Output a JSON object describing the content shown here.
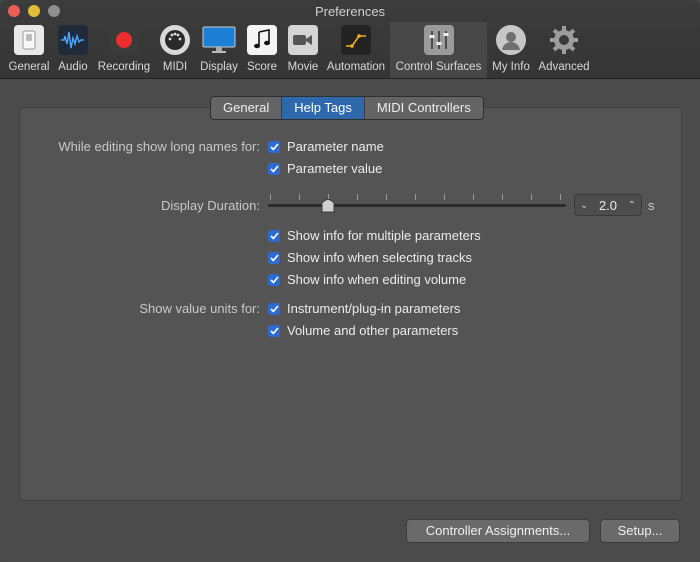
{
  "window": {
    "title": "Preferences"
  },
  "toolbar": {
    "items": [
      {
        "label": "General",
        "icon": "switch-icon"
      },
      {
        "label": "Audio",
        "icon": "waveform-icon"
      },
      {
        "label": "Recording",
        "icon": "record-icon"
      },
      {
        "label": "MIDI",
        "icon": "midi-connector-icon"
      },
      {
        "label": "Display",
        "icon": "monitor-icon"
      },
      {
        "label": "Score",
        "icon": "music-note-icon"
      },
      {
        "label": "Movie",
        "icon": "video-camera-icon"
      },
      {
        "label": "Automation",
        "icon": "automation-curve-icon"
      },
      {
        "label": "Control Surfaces",
        "icon": "faders-icon",
        "selected": true
      },
      {
        "label": "My Info",
        "icon": "person-icon"
      },
      {
        "label": "Advanced",
        "icon": "gear-icon"
      }
    ]
  },
  "tabs": [
    {
      "label": "General",
      "active": false
    },
    {
      "label": "Help Tags",
      "active": true
    },
    {
      "label": "MIDI Controllers",
      "active": false
    }
  ],
  "long_names": {
    "label": "While editing show long names for:",
    "options": [
      {
        "label": "Parameter name",
        "checked": true
      },
      {
        "label": "Parameter value",
        "checked": true
      }
    ]
  },
  "display_duration": {
    "label": "Display Duration:",
    "value": "2.0",
    "unit": "s"
  },
  "info_options": [
    {
      "label": "Show info for multiple parameters",
      "checked": true
    },
    {
      "label": "Show info when selecting tracks",
      "checked": true
    },
    {
      "label": "Show info when editing volume",
      "checked": true
    }
  ],
  "value_units": {
    "label": "Show value units for:",
    "options": [
      {
        "label": "Instrument/plug-in parameters",
        "checked": true
      },
      {
        "label": "Volume and other parameters",
        "checked": true
      }
    ]
  },
  "buttons": {
    "controller_assignments": "Controller Assignments...",
    "setup": "Setup..."
  },
  "colors": {
    "accent": "#2f69ad",
    "checkbox": "#2e6bd1",
    "close": "#ec5f57",
    "minimize": "#dfbf3a"
  }
}
